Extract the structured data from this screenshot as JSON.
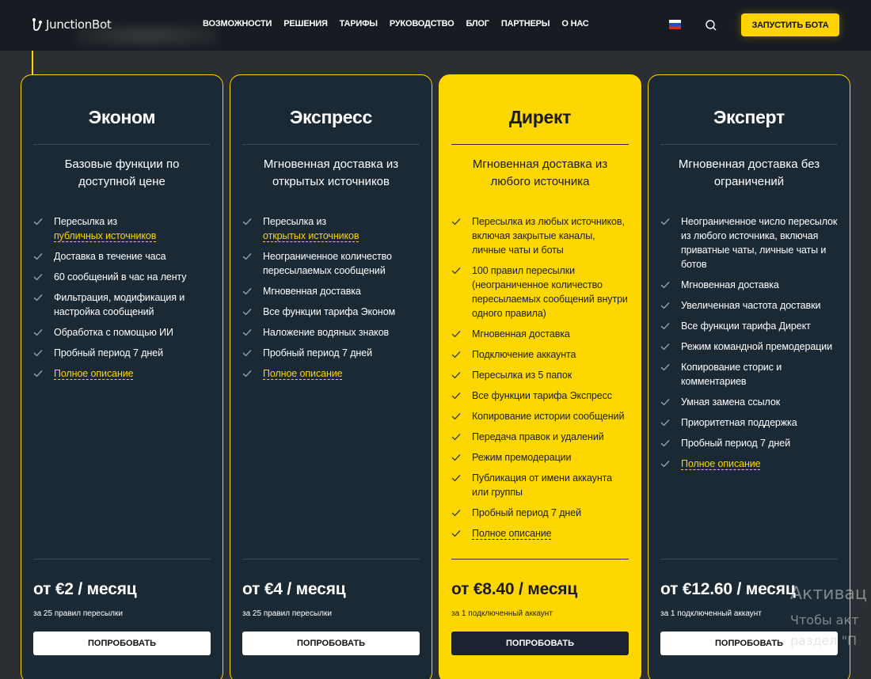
{
  "header": {
    "logo_text": "JunctionBot",
    "nav": [
      "ВОЗМОЖНОСТИ",
      "РЕШЕНИЯ",
      "ТАРИФЫ",
      "РУКОВОДСТВО",
      "БЛОГ",
      "ПАРТНЕРЫ",
      "О НАС"
    ],
    "cta_label": "ЗАПУСТИТЬ БОТА",
    "accent_color": "#ffd400"
  },
  "plans": [
    {
      "title": "Эконом",
      "subtitle": "Базовые функции по доступной цене",
      "features": [
        {
          "text": "Пересылка из ",
          "link": "публичных источников"
        },
        {
          "text": "Доставка в течение часа"
        },
        {
          "text": "60 сообщений в час на ленту"
        },
        {
          "text": "Фильтрация, модификация и настройка сообщений"
        },
        {
          "text": "Обработка с помощью ИИ"
        },
        {
          "text": "Пробный период 7 дней"
        },
        {
          "text": "",
          "link": "Полное описание"
        }
      ],
      "price": "от  €2 / месяц",
      "price_note": "за 25 правил пересылки",
      "button": "ПОПРОБОВАТЬ"
    },
    {
      "title": "Экспресс",
      "subtitle": "Мгновенная доставка из открытых источников",
      "features": [
        {
          "text": "Пересылка из ",
          "link": "открытых источников"
        },
        {
          "text": "Неограниченное количество пересылаемых сообщений"
        },
        {
          "text": "Мгновенная доставка"
        },
        {
          "text": "Все функции тарифа Эконом"
        },
        {
          "text": "Наложение водяных знаков"
        },
        {
          "text": "Пробный период 7 дней"
        },
        {
          "text": "",
          "link": "Полное описание"
        }
      ],
      "price": "от  €4 / месяц",
      "price_note": "за 25 правил пересылки",
      "button": "ПОПРОБОВАТЬ"
    },
    {
      "title": "Директ",
      "subtitle": "Мгновенная доставка из любого источника",
      "features": [
        {
          "text": "Пересылка из любых источников, включая закрытые каналы, личные чаты и боты"
        },
        {
          "text": "100 правил пересылки (неограниченное количество пересылаемых сообщений внутри одного правила)"
        },
        {
          "text": "Мгновенная доставка"
        },
        {
          "text": "Подключение аккаунта"
        },
        {
          "text": "Пересылка из 5 папок"
        },
        {
          "text": "Все функции тарифа Экспресс"
        },
        {
          "text": "Копирование истории сообщений"
        },
        {
          "text": "Передача правок и удалений"
        },
        {
          "text": "Режим премодерации"
        },
        {
          "text": "Публикация от имени аккаунта или группы"
        },
        {
          "text": "Пробный период 7 дней"
        },
        {
          "text": "",
          "link": "Полное описание"
        }
      ],
      "price": "от  €8.40 / месяц",
      "price_note": "за 1 подключенный аккаунт",
      "button": "ПОПРОБОВАТЬ"
    },
    {
      "title": "Эксперт",
      "subtitle": "Мгновенная доставка без ограничений",
      "features": [
        {
          "text": "Неограниченное число пересылок из любого источника, включая приватные чаты, личные чаты и ботов"
        },
        {
          "text": "Мгновенная доставка"
        },
        {
          "text": "Увеличенная частота доставки"
        },
        {
          "text": "Все функции тарифа Директ"
        },
        {
          "text": "Режим командной премодерации"
        },
        {
          "text": "Копирование сторис и комментариев"
        },
        {
          "text": "Умная замена ссылок"
        },
        {
          "text": "Приоритетная поддержка"
        },
        {
          "text": "Пробный период 7 дней"
        },
        {
          "text": "",
          "link": "Полное описание"
        }
      ],
      "price": "от  €12.60 / месяц",
      "price_note": "за 1 подключенный аккаунт",
      "button": "ПОПРОБОВАТЬ"
    }
  ],
  "watermark": {
    "line1": "Активац",
    "line2": "Чтобы акт",
    "line3": "раздел \"П"
  }
}
